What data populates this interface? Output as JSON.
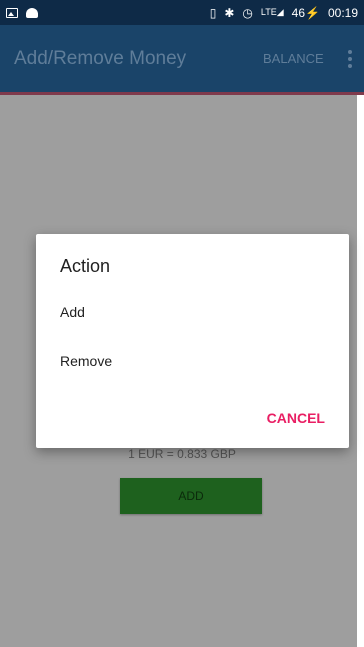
{
  "status_bar": {
    "network": "LTE",
    "battery": "46",
    "battery_charging": "⚡",
    "time": "00:19"
  },
  "app_bar": {
    "title": "Add/Remove Money",
    "balance_label": "BALANCE"
  },
  "content": {
    "rate_text": "1 EUR = 0.833 GBP",
    "add_label": "ADD"
  },
  "dialog": {
    "title": "Action",
    "options": [
      "Add",
      "Remove"
    ],
    "cancel_label": "CANCEL"
  },
  "colors": {
    "status_bar": "#0e2a47",
    "app_bar": "#1a4469",
    "dialog_accent": "#e91e63",
    "add_button": "#1e611e"
  }
}
